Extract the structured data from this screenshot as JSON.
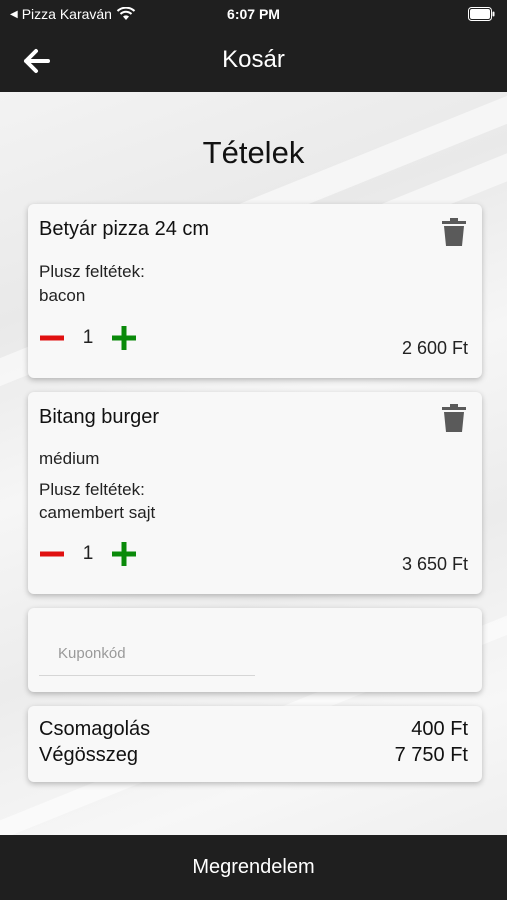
{
  "status_bar": {
    "back_app": "Pizza Karaván",
    "time": "6:07 PM"
  },
  "header": {
    "title": "Kosár",
    "back_icon": "arrow-left-icon"
  },
  "main": {
    "section_title": "Tételek",
    "items": [
      {
        "name": "Betyár pizza 24 cm",
        "extras_label": "Plusz feltétek:",
        "extras": "bacon",
        "quantity": "1",
        "price": "2 600 Ft"
      },
      {
        "name": "Bitang burger",
        "variant": "médium",
        "extras_label": "Plusz feltétek:",
        "extras": "camembert sajt",
        "quantity": "1",
        "price": "3 650 Ft"
      }
    ],
    "coupon": {
      "placeholder": "Kuponkód",
      "value": ""
    },
    "summary": {
      "packaging_label": "Csomagolás",
      "packaging_value": "400 Ft",
      "total_label": "Végösszeg",
      "total_value": "7 750 Ft"
    }
  },
  "footer": {
    "order_button": "Megrendelem"
  },
  "colors": {
    "bar": "#1f1f1f",
    "minus": "#e01010",
    "plus": "#0a8a0a",
    "trash": "#5a5a5a"
  }
}
